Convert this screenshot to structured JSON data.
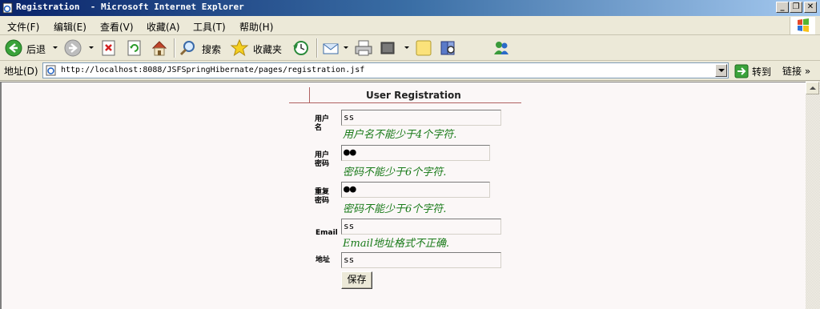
{
  "window": {
    "title": "Registration  - Microsoft Internet Explorer",
    "minimize": "_",
    "maximize": "❐",
    "close": "✕"
  },
  "menu": [
    "文件(F)",
    "编辑(E)",
    "查看(V)",
    "收藏(A)",
    "工具(T)",
    "帮助(H)"
  ],
  "toolbar": {
    "back": "后退",
    "search": "搜索",
    "favorites": "收藏夹"
  },
  "address": {
    "label": "地址(D)",
    "url": "http://localhost:8088/JSFSpringHibernate/pages/registration.jsf",
    "go": "转到",
    "links": "链接"
  },
  "form": {
    "title": "User Registration",
    "fields": [
      {
        "label": "用户名",
        "value": "ss",
        "error": "用户名不能少于4个字符."
      },
      {
        "label": "用户密码",
        "value": "●●",
        "error": "密码不能少于6个字符."
      },
      {
        "label": "重复密码",
        "value": "●●",
        "error": "密码不能少于6个字符."
      },
      {
        "label": "Email",
        "value": "ss",
        "error": "Email地址格式不正确."
      },
      {
        "label": "地址",
        "value": "ss",
        "error": ""
      }
    ],
    "save": "保存"
  },
  "colors": {
    "titlebar_start": "#0a246a",
    "error_text": "#187a18",
    "page_bg": "#fbf7f7"
  },
  "icons": [
    "ie-page-icon",
    "back-icon",
    "forward-icon",
    "stop-icon",
    "refresh-icon",
    "home-icon",
    "search-icon",
    "favorites-star-icon",
    "history-icon",
    "mail-icon",
    "print-icon",
    "edit-icon",
    "discuss-icon",
    "research-icon",
    "messenger-icon",
    "windows-logo-icon",
    "go-arrow-icon"
  ]
}
